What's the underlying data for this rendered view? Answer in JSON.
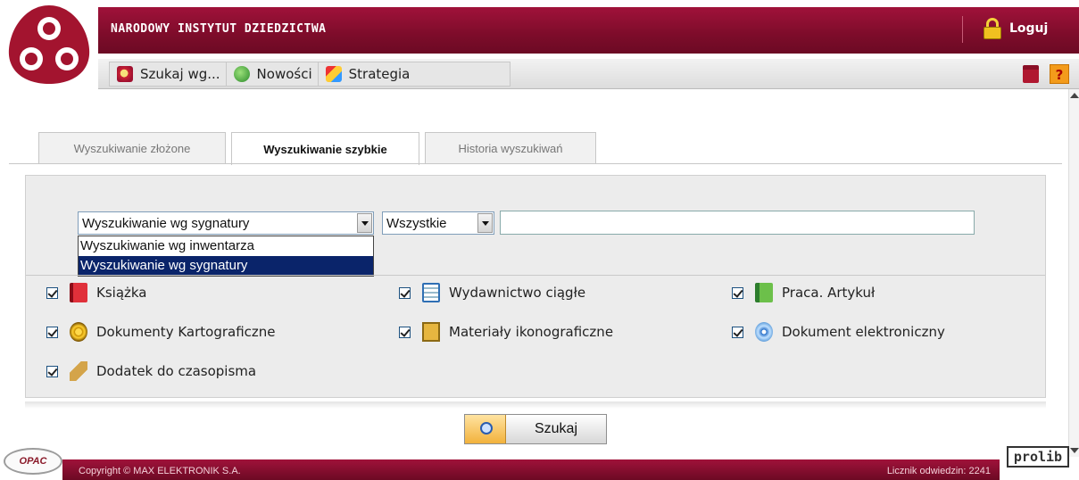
{
  "header": {
    "title": "NARODOWY INSTYTUT DZIEDZICTWA",
    "login_label": "Loguj"
  },
  "nav": {
    "items": [
      {
        "label": "Szukaj wg...",
        "icon": "search-icon"
      },
      {
        "label": "Nowości",
        "icon": "news-icon"
      },
      {
        "label": "Strategia",
        "icon": "strategy-icon"
      }
    ],
    "right_icons": [
      "gift-icon",
      "help-icon"
    ]
  },
  "tabs": [
    {
      "label": "Wyszukiwanie złożone",
      "active": false
    },
    {
      "label": "Wyszukiwanie szybkie",
      "active": true
    },
    {
      "label": "Historia wyszukiwań",
      "active": false
    }
  ],
  "search": {
    "search_type_selected": "Wyszukiwanie wg sygnatury",
    "search_type_options": [
      "Wyszukiwanie wg inwentarza",
      "Wyszukiwanie wg sygnatury"
    ],
    "scope_selected": "Wszystkie",
    "query_value": ""
  },
  "doc_types": [
    {
      "label": "Książka",
      "checked": true,
      "icon": "book-icon"
    },
    {
      "label": "Wydawnictwo ciągłe",
      "checked": true,
      "icon": "serial-icon"
    },
    {
      "label": "Praca. Artykuł",
      "checked": true,
      "icon": "article-icon"
    },
    {
      "label": "Dokumenty Kartograficzne",
      "checked": true,
      "icon": "map-icon"
    },
    {
      "label": "Materiały ikonograficzne",
      "checked": true,
      "icon": "iconography-icon"
    },
    {
      "label": "Dokument elektroniczny",
      "checked": true,
      "icon": "cd-icon"
    },
    {
      "label": "Dodatek do czasopisma",
      "checked": true,
      "icon": "supplement-icon"
    }
  ],
  "search_button_label": "Szukaj",
  "footer": {
    "copyright": "Copyright © MAX ELEKTRONIK S.A.",
    "counter": "Licznik odwiedzin: 2241",
    "opac_logo": "OPAC",
    "prolib_logo": "prolib"
  },
  "colors": {
    "brand": "#8a0f2e",
    "selection": "#0a246a"
  }
}
